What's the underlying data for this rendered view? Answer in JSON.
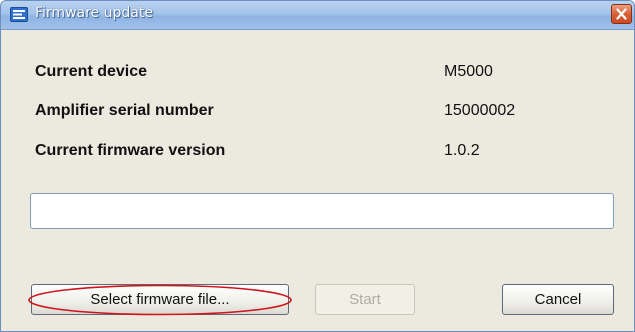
{
  "window": {
    "title": "Firmware update"
  },
  "info": {
    "rows": [
      {
        "label": "Current device",
        "value": "M5000"
      },
      {
        "label": "Amplifier serial number",
        "value": "15000002"
      },
      {
        "label": "Current firmware version",
        "value": "1.0.2"
      }
    ]
  },
  "file_field": {
    "value": ""
  },
  "buttons": {
    "select_file": "Select firmware file...",
    "start": "Start",
    "cancel": "Cancel"
  },
  "colors": {
    "annotation_ellipse": "#d0141c",
    "title_bar": "#a3c3ea",
    "close_button": "#d8613a"
  },
  "icons": {
    "app": "firmware-window-icon",
    "close": "close-icon"
  }
}
